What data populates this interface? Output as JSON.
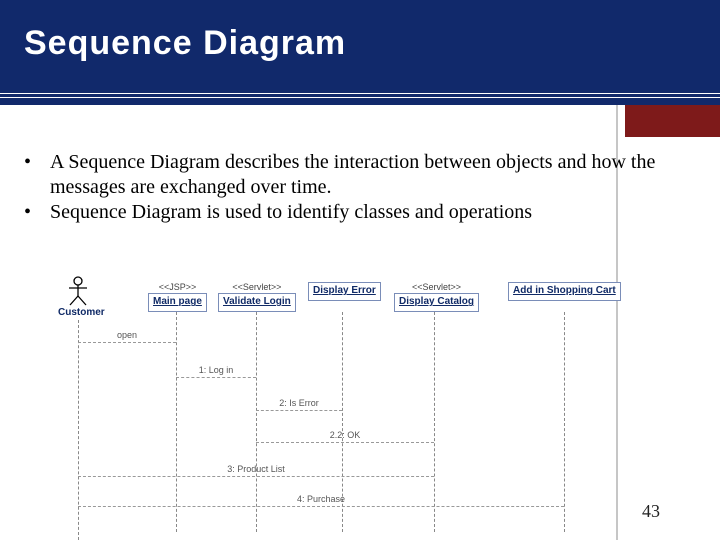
{
  "header": {
    "title": "Sequence Diagram"
  },
  "bullets": [
    "A Sequence Diagram describes the interaction between objects and how the messages are exchanged over time.",
    "Sequence Diagram is used to identify classes and operations"
  ],
  "diagram": {
    "actor": "Customer",
    "participants": [
      {
        "stereo": "<<JSP>>",
        "name": "Main page"
      },
      {
        "stereo": "<<Servlet>>",
        "name": "Validate Login"
      },
      {
        "stereo": "",
        "name": "Display Error"
      },
      {
        "stereo": "<<Servlet>>",
        "name": "Display Catalog"
      },
      {
        "stereo": "",
        "name": "Add in Shopping Cart"
      }
    ],
    "messages": [
      {
        "label": "open"
      },
      {
        "label": "1: Log in"
      },
      {
        "label": "2: Is Error"
      },
      {
        "label": "2.2: OK"
      },
      {
        "label": "3: Product List"
      },
      {
        "label": "4: Purchase"
      }
    ]
  },
  "slide_number": "43"
}
